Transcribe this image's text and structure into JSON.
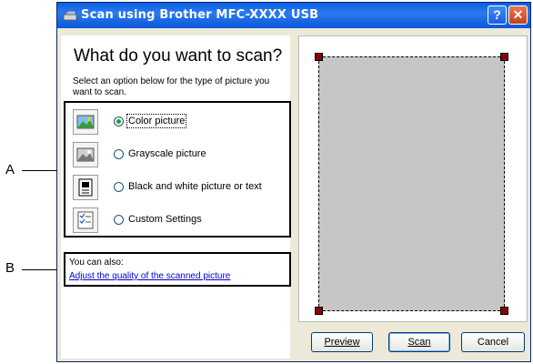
{
  "window": {
    "title": "Scan using Brother MFC-XXXX  USB",
    "help_label": "?",
    "close_label": "✕"
  },
  "left": {
    "heading": "What do you want to scan?",
    "description": "Select an option below for the type of picture you want to scan.",
    "options": [
      {
        "label": "Color picture",
        "selected": true,
        "icon": "color-picture-icon"
      },
      {
        "label": "Grayscale picture",
        "selected": false,
        "icon": "grayscale-picture-icon"
      },
      {
        "label": "Black and white picture or text",
        "selected": false,
        "icon": "bw-picture-icon"
      },
      {
        "label": "Custom Settings",
        "selected": false,
        "icon": "custom-settings-icon"
      }
    ],
    "also_text": "You can also:",
    "adjust_link": "Adjust the quality of the scanned picture"
  },
  "buttons": {
    "preview": "Preview",
    "scan": "Scan",
    "cancel": "Cancel"
  },
  "callouts": {
    "a": "A",
    "b": "B"
  },
  "colors": {
    "titlebar": "#0a5fe0",
    "window_bg": "#ece9d8",
    "scan_area": "#c6c6c6",
    "handle": "#8b0000",
    "link": "#0000cc",
    "radio_dot": "#21a121"
  }
}
